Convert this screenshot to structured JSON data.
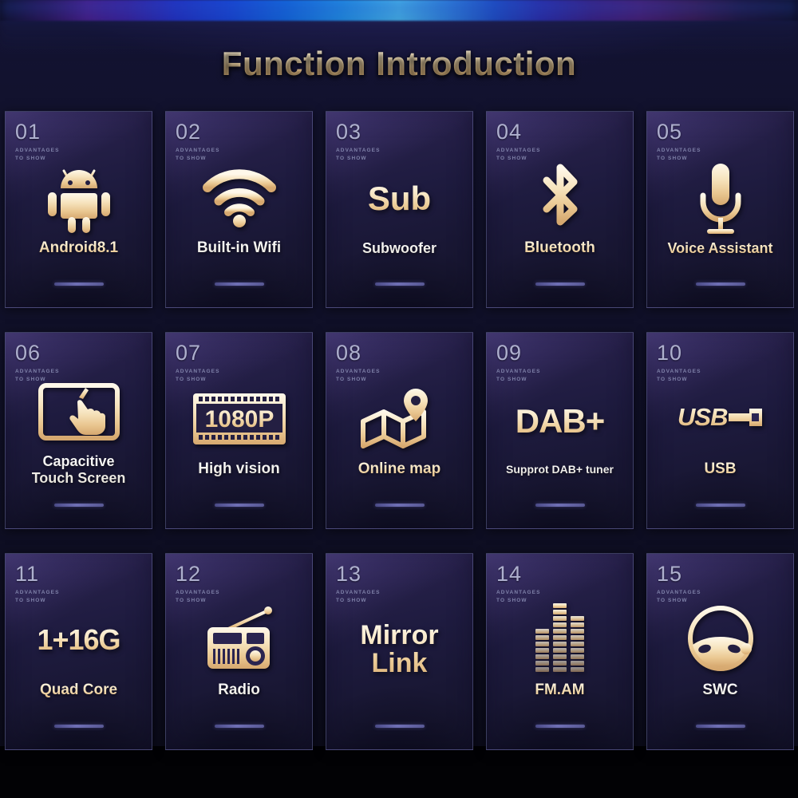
{
  "page": {
    "title": "Function Introduction",
    "card_subtitle": "ADVANTAGES\nTO SHOW"
  },
  "colors": {
    "gold": "#f0d6a6",
    "gold_light": "#fff8ea",
    "gold_dark": "#d9ae76",
    "card_bg_top": "#2b2552",
    "card_bg_bottom": "#15142b",
    "page_bg": "#101028",
    "number": "#b9bcd8",
    "divider": "#6f6fb4",
    "neon_blue": "#49c4f6",
    "neon_purple": "#4b1a86"
  },
  "cards": [
    {
      "number": "01",
      "subtitle": "ADVANTAGES\nTO SHOW",
      "icon": "android-icon",
      "label": "Android8.1",
      "label_style": "gold",
      "label_size": "lbl-lg"
    },
    {
      "number": "02",
      "subtitle": "ADVANTAGES\nTO SHOW",
      "icon": "wifi-icon",
      "label": "Built-in Wifi",
      "label_style": "white",
      "label_size": "lbl-lg"
    },
    {
      "number": "03",
      "subtitle": "ADVANTAGES\nTO SHOW",
      "icon": "sub-text-icon",
      "icon_text": "Sub",
      "label": "Subwoofer",
      "label_style": "white",
      "label_size": "lbl-md"
    },
    {
      "number": "04",
      "subtitle": "ADVANTAGES\nTO SHOW",
      "icon": "bluetooth-icon",
      "label": "Bluetooth",
      "label_style": "gold",
      "label_size": "lbl-lg"
    },
    {
      "number": "05",
      "subtitle": "ADVANTAGES\nTO SHOW",
      "icon": "microphone-icon",
      "label": "Voice Assistant",
      "label_style": "gold",
      "label_size": "lbl-md"
    },
    {
      "number": "06",
      "subtitle": "ADVANTAGES\nTO SHOW",
      "icon": "touch-screen-icon",
      "label": "Capacitive\nTouch Screen",
      "label_style": "white",
      "label_size": "lbl-md"
    },
    {
      "number": "07",
      "subtitle": "ADVANTAGES\nTO SHOW",
      "icon": "film-1080p-icon",
      "icon_text": "1080P",
      "label": "High vision",
      "label_style": "white",
      "label_size": "lbl-lg"
    },
    {
      "number": "08",
      "subtitle": "ADVANTAGES\nTO SHOW",
      "icon": "map-pin-icon",
      "label": "Online map",
      "label_style": "gold",
      "label_size": "lbl-lg"
    },
    {
      "number": "09",
      "subtitle": "ADVANTAGES\nTO SHOW",
      "icon": "dab-plus-text-icon",
      "icon_text": "DAB+",
      "label": "Supprot DAB+ tuner",
      "label_style": "white",
      "label_size": "lbl-xs"
    },
    {
      "number": "10",
      "subtitle": "ADVANTAGES\nTO SHOW",
      "icon": "usb-icon",
      "label": "USB",
      "label_style": "gold",
      "label_size": "lbl-lg"
    },
    {
      "number": "11",
      "subtitle": "ADVANTAGES\nTO SHOW",
      "icon": "memory-text-icon",
      "icon_text": "1+16G",
      "label": "Quad Core",
      "label_style": "gold",
      "label_size": "lbl-lg"
    },
    {
      "number": "12",
      "subtitle": "ADVANTAGES\nTO SHOW",
      "icon": "radio-icon",
      "label": "Radio",
      "label_style": "white",
      "label_size": "lbl-lg"
    },
    {
      "number": "13",
      "subtitle": "ADVANTAGES\nTO SHOW",
      "icon": "mirror-link-text-icon",
      "icon_text": "Mirror\nLink",
      "label": "",
      "label_style": "gold",
      "label_size": "lbl-lg"
    },
    {
      "number": "14",
      "subtitle": "ADVANTAGES\nTO SHOW",
      "icon": "equalizer-icon",
      "label": "FM.AM",
      "label_style": "gold",
      "label_size": "lbl-lg"
    },
    {
      "number": "15",
      "subtitle": "ADVANTAGES\nTO SHOW",
      "icon": "steering-wheel-icon",
      "label": "SWC",
      "label_style": "white",
      "label_size": "lbl-lg"
    }
  ]
}
